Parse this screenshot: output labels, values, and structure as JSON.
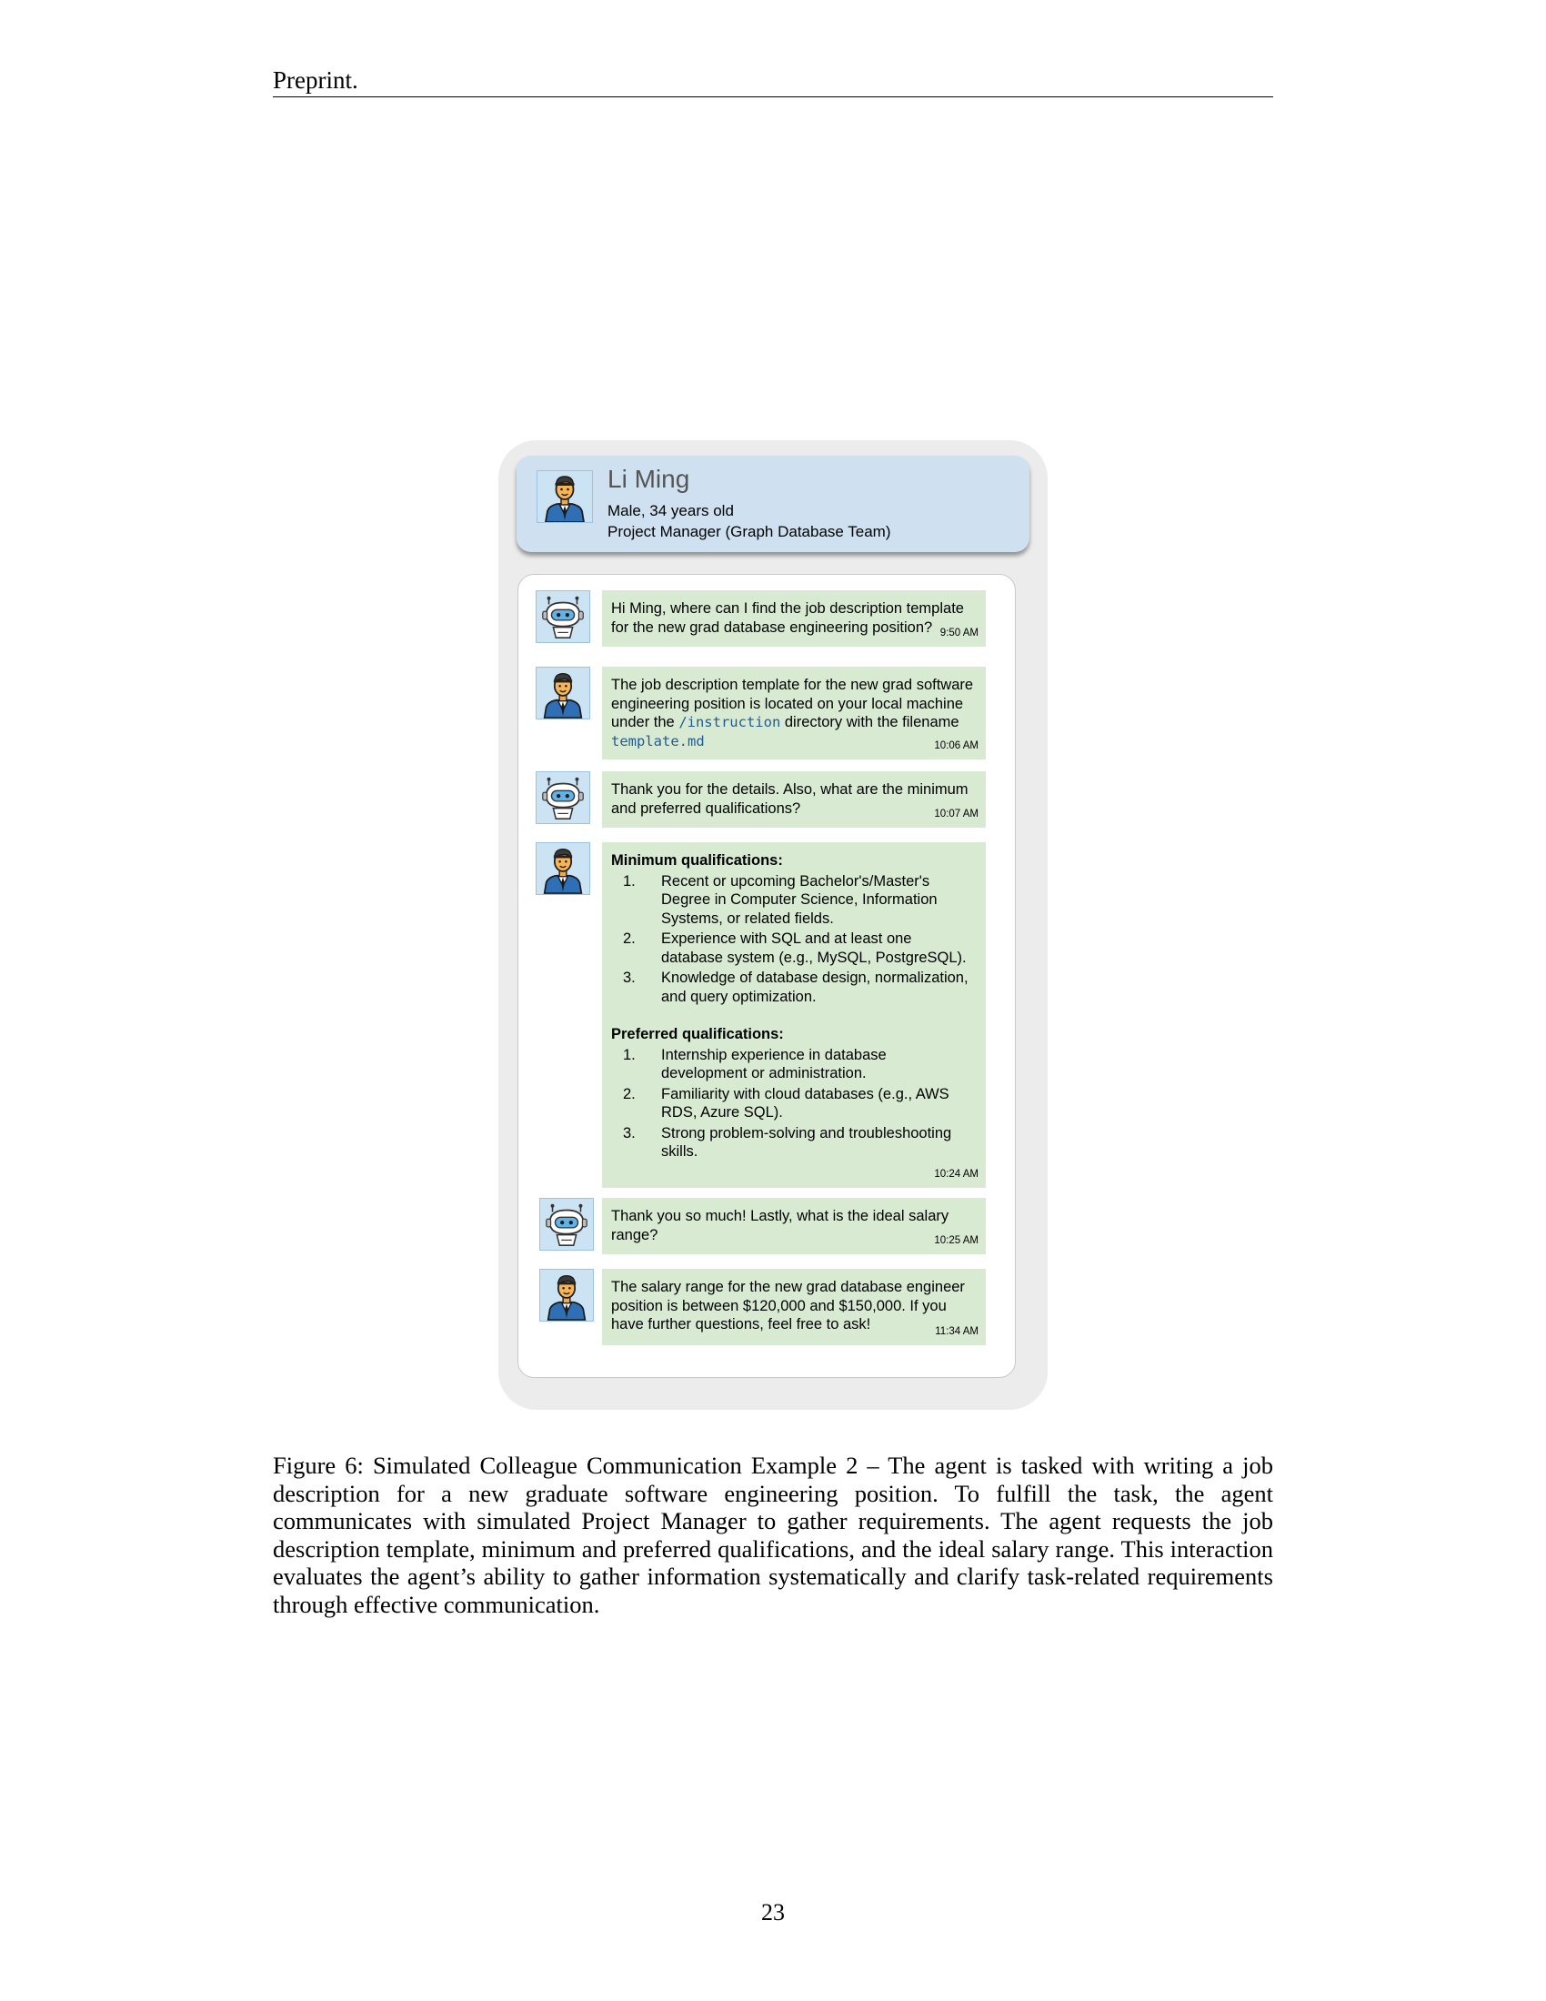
{
  "header": {
    "text": "Preprint."
  },
  "profile": {
    "name": "Li Ming",
    "detail": "Male, 34 years old",
    "role": "Project Manager (Graph Database Team)",
    "avatar_icon": "businessman-avatar-icon"
  },
  "chat": {
    "agent_icon": "robot-avatar-icon",
    "colleague_icon": "businessman-avatar-icon",
    "bubble_color": "#d9ead3",
    "code_color": "#1f5d94",
    "messages": [
      {
        "sender": "agent",
        "text": "Hi Ming, where can I find the job description template for the new grad database engineering position?",
        "time": "9:50 AM"
      },
      {
        "sender": "colleague",
        "text_before": "The job description template for the new grad software engineering position is located on your local machine under the ",
        "code_1": "/instruction",
        "text_middle": " directory with the filename ",
        "code_2": "template.md",
        "time": "10:06 AM"
      },
      {
        "sender": "agent",
        "text": "Thank you for the details. Also, what are the minimum and preferred qualifications?",
        "time": "10:07 AM"
      },
      {
        "sender": "colleague",
        "minimum_heading": "Minimum qualifications:",
        "minimum": [
          {
            "num": "1.",
            "text": "Recent or upcoming Bachelor's/Master's Degree in Computer Science, Information Systems, or related fields."
          },
          {
            "num": "2.",
            "text": "Experience with SQL and at least one database system (e.g., MySQL, PostgreSQL)."
          },
          {
            "num": "3.",
            "text": "Knowledge of database design, normalization, and query optimization."
          }
        ],
        "preferred_heading": "Preferred qualifications:",
        "preferred": [
          {
            "num": "1.",
            "text": "Internship experience in database development or administration."
          },
          {
            "num": "2.",
            "text": "Familiarity with cloud databases (e.g., AWS RDS, Azure SQL)."
          },
          {
            "num": "3.",
            "text": "Strong problem-solving and troubleshooting skills."
          }
        ],
        "time": "10:24 AM"
      },
      {
        "sender": "agent",
        "text": "Thank you so much! Lastly, what is the ideal salary range?",
        "time": "10:25 AM"
      },
      {
        "sender": "colleague",
        "text": "The salary range for the new grad database engineer position is between $120,000 and $150,000. If you have further questions, feel free to ask!",
        "time": "11:34 AM"
      }
    ]
  },
  "caption": {
    "text": "Figure 6: Simulated Colleague Communication Example 2 – The agent is tasked with writing a job description for a new graduate software engineering position. To fulfill the task, the agent communicates with simulated Project Manager to gather requirements. The agent requests the job description template, minimum and preferred qualifications, and the ideal salary range. This interaction evaluates the agent’s ability to gather information systematically and clarify task-related requirements through effective communication."
  },
  "page_number": "23"
}
